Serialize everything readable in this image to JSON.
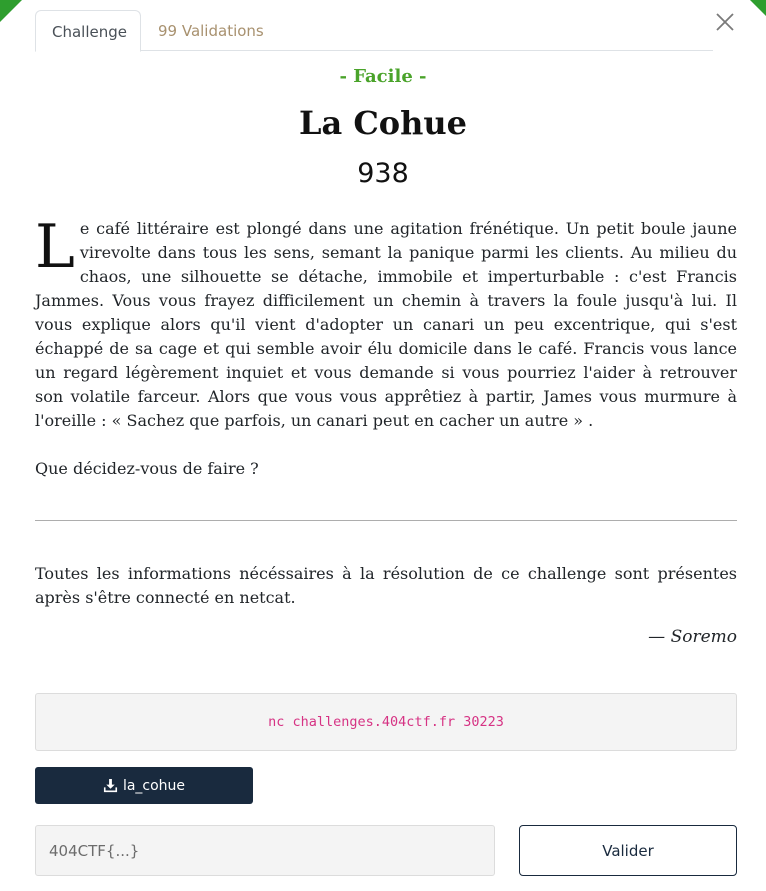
{
  "tabs": [
    {
      "label": "Challenge",
      "active": true
    },
    {
      "label": "99 Validations",
      "active": false
    }
  ],
  "challenge": {
    "difficulty": "- Facile -",
    "name": "La Cohue",
    "points": "938",
    "dropcap": "L",
    "story": "e café littéraire est plongé dans une agitation frénétique. Un petit boule jaune virevolte dans tous les sens, semant la panique parmi les clients. Au milieu du chaos, une silhouette se détache, immobile et imperturbable : c'est Francis Jammes. Vous vous frayez difficilement un chemin à travers la foule jusqu'à lui. Il vous explique alors qu'il vient d'adopter un canari un peu excentrique, qui s'est échappé de sa cage et qui semble avoir élu domicile dans le café. Francis vous lance un regard légèrement inquiet et vous demande si vous pourriez l'aider à retrouver son volatile farceur. Alors que vous vous apprêtiez à partir, James vous murmure à l'oreille : « Sachez que parfois, un canari peut en cacher un autre » .",
    "question": "Que décidez-vous de faire ?",
    "info": "Toutes les informations nécéssaires à la résolution de ce challenge sont présentes après s'être connecté en netcat.",
    "author": "— Soremo"
  },
  "connection": {
    "command": "nc challenges.404ctf.fr 30223"
  },
  "download": {
    "label": "la_cohue",
    "icon": "download-icon"
  },
  "flag_form": {
    "placeholder": "404CTF{...}",
    "value": "",
    "submit_label": "Valider"
  },
  "colors": {
    "accent_green": "#2e9e2e",
    "difficulty": "#4aa32a",
    "navy": "#192a3e",
    "code": "#d63384"
  }
}
